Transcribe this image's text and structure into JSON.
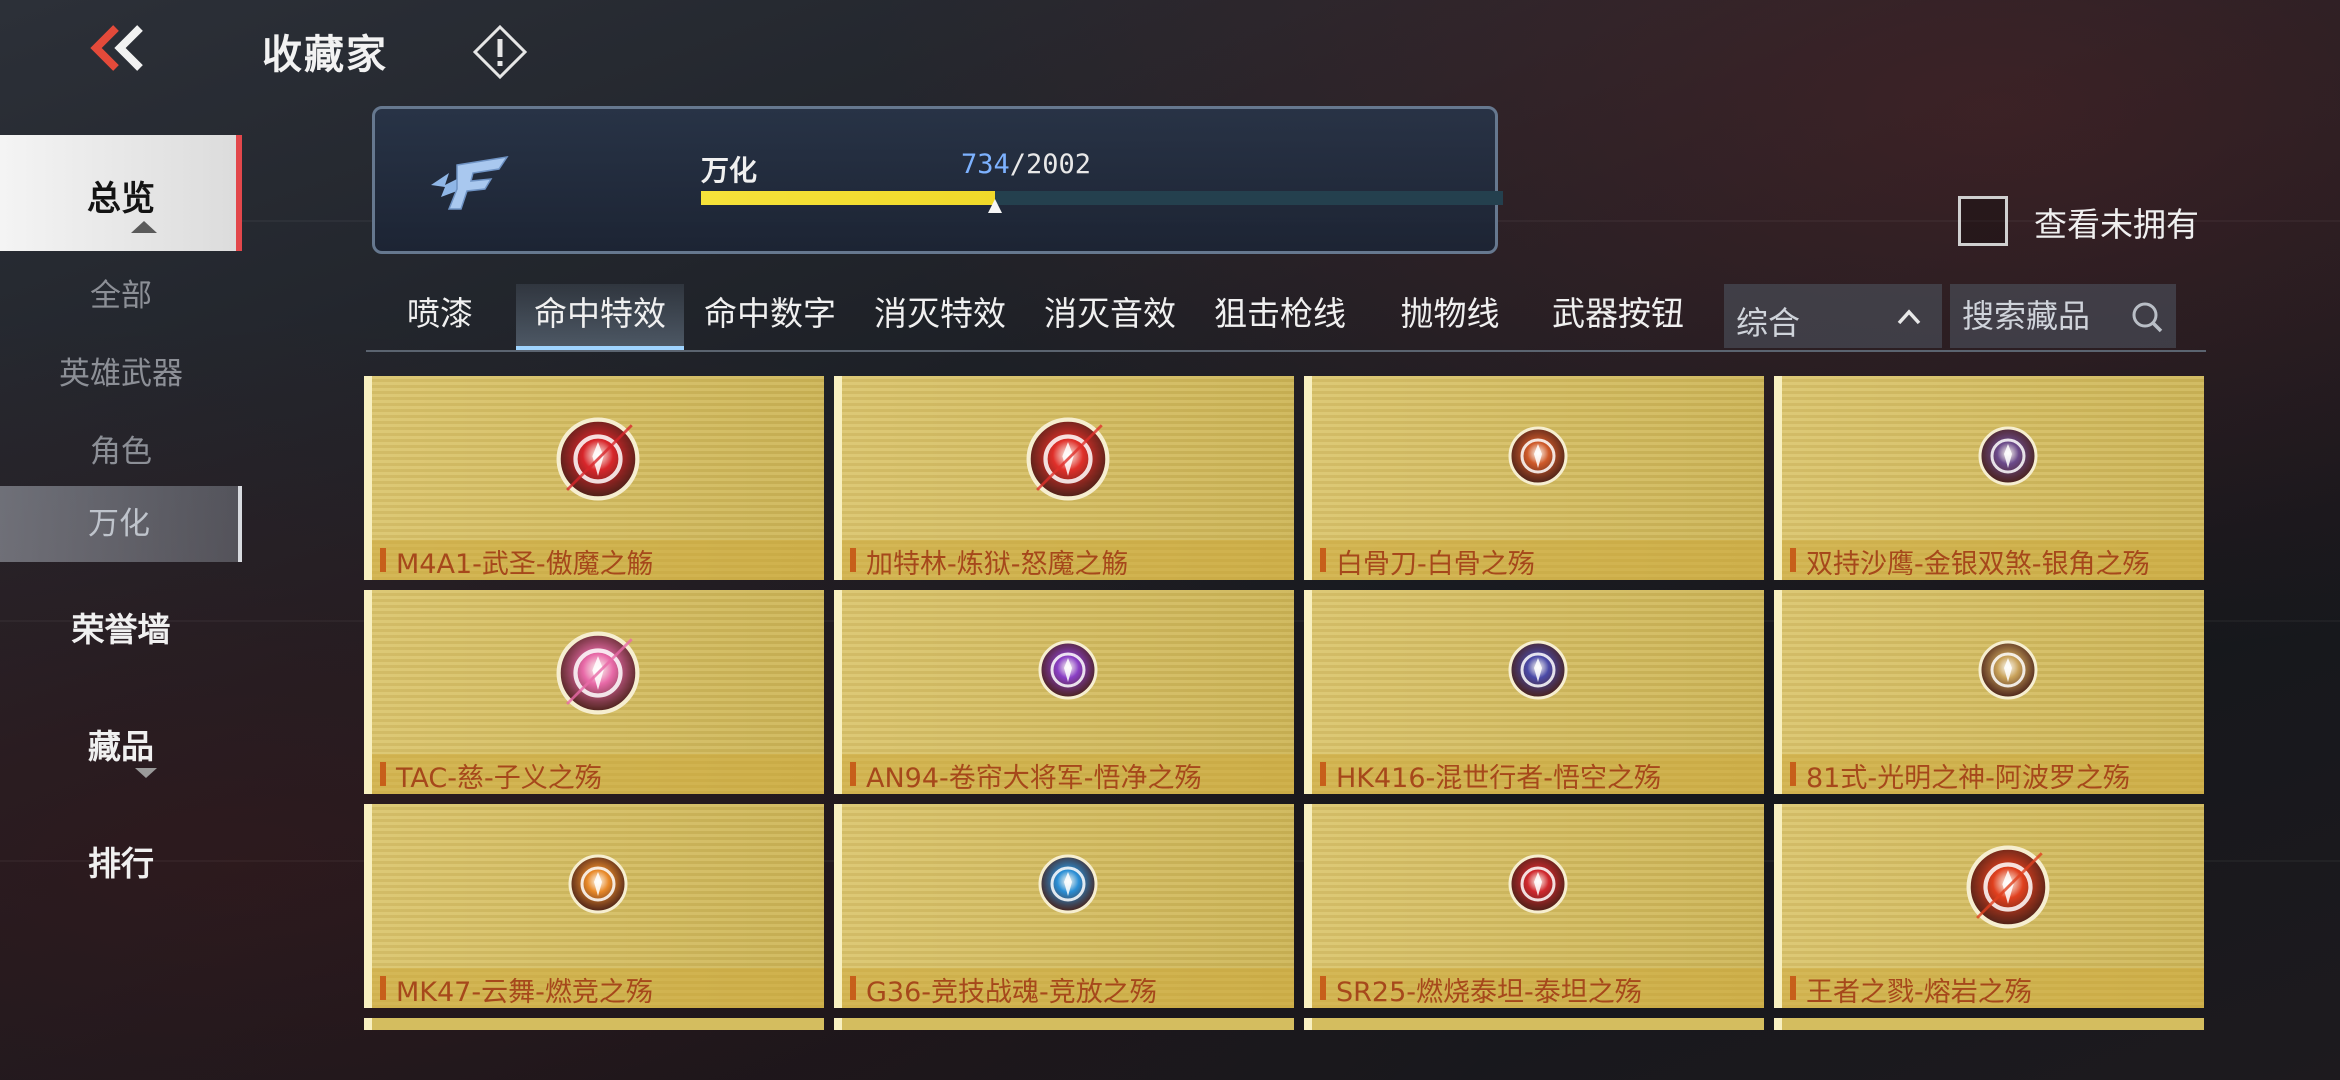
{
  "header": {
    "title": "收藏家",
    "back_icon": "double-chevron-left-icon",
    "info_icon": "exclamation-diamond-icon"
  },
  "sidebar": {
    "overview": "总览",
    "sub_items": [
      "全部",
      "英雄武器",
      "角色",
      "万化"
    ],
    "active_sub": "万化",
    "honor_wall": "荣誉墙",
    "collectibles": "藏品",
    "ranking": "排行"
  },
  "progress": {
    "label": "万化",
    "current": "734",
    "total": "/2002",
    "fraction": 0.367
  },
  "filter": {
    "unowned_label": "查看未拥有",
    "unowned_checked": false
  },
  "tabs": [
    "喷漆",
    "命中特效",
    "命中数字",
    "消灭特效",
    "消灭音效",
    "狙击枪线",
    "抛物线",
    "武器按钮"
  ],
  "active_tab": "命中特效",
  "sort": {
    "value": "综合"
  },
  "search": {
    "placeholder": "搜索藏品"
  },
  "items": [
    {
      "label": "M4A1-武圣-傲魔之觞",
      "icon": "red-flame-emblem-icon",
      "color": "#d8262b"
    },
    {
      "label": "加特林-炼狱-怒魔之觞",
      "icon": "red-fire-emblem-icon",
      "color": "#e0302a"
    },
    {
      "label": "白骨刀-白骨之殇",
      "icon": "bone-claw-emblem-icon",
      "color": "#cf5a2a"
    },
    {
      "label": "双持沙鹰-金银双煞-银角之殇",
      "icon": "silver-seal-emblem-icon",
      "color": "#6b4a8a"
    },
    {
      "label": "TAC-慈-子义之殇",
      "icon": "yin-yang-emblem-icon",
      "color": "#e86aa8"
    },
    {
      "label": "AN94-卷帘大将军-悟净之殇",
      "icon": "purple-orb-emblem-icon",
      "color": "#8a3fc6"
    },
    {
      "label": "HK416-混世行者-悟空之殇",
      "icon": "mask-emblem-icon",
      "color": "#4a4aa8"
    },
    {
      "label": "81式-光明之神-阿波罗之殇",
      "icon": "sun-emblem-icon",
      "color": "#c9a25a"
    },
    {
      "label": "MK47-云舞-燃竞之殇",
      "icon": "striped-shield-emblem-icon",
      "color": "#e98a2a"
    },
    {
      "label": "G36-竞技战魂-竞放之殇",
      "icon": "blue-visor-emblem-icon",
      "color": "#2a8fd6"
    },
    {
      "label": "SR25-燃烧泰坦-泰坦之殇",
      "icon": "red-wing-emblem-icon",
      "color": "#d0282e"
    },
    {
      "label": "王者之戮-熔岩之殇",
      "icon": "lava-star-emblem-icon",
      "color": "#e0401e"
    }
  ]
}
